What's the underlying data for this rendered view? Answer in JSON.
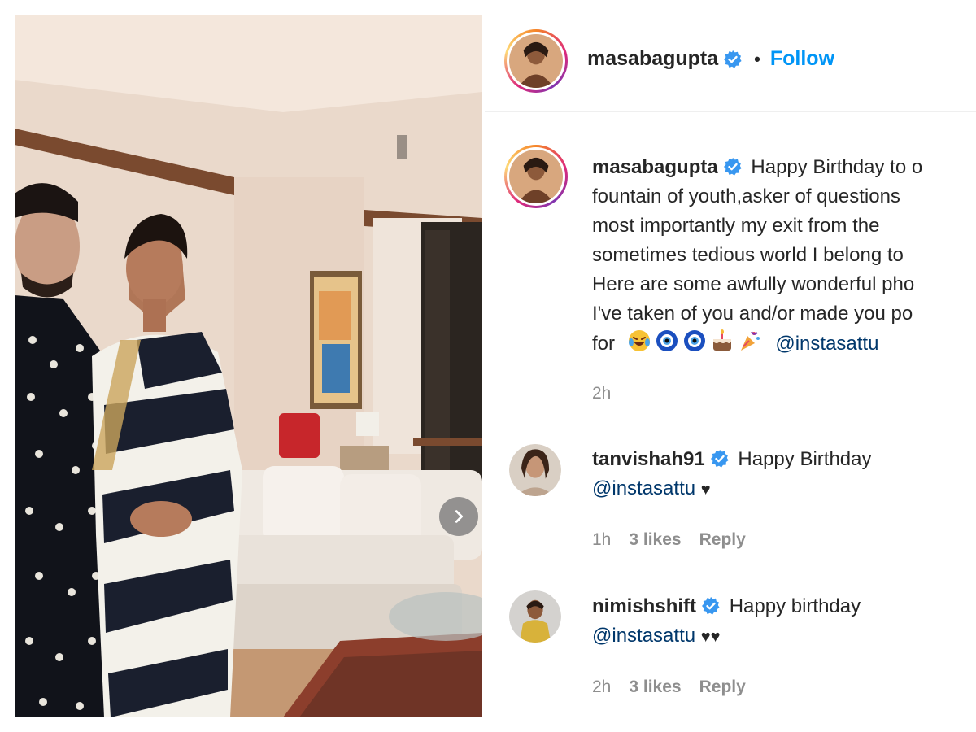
{
  "post": {
    "username": "masabagupta",
    "dot": "•",
    "follow_label": "Follow",
    "caption_lines": [
      "Happy Birthday to o",
      "fountain of youth,asker of questions",
      "most importantly my exit from the",
      "sometimes tedious world I belong to",
      "Here are some awfully wonderful pho",
      "I've taken of you and/or made you po"
    ],
    "caption_last_prefix": "for",
    "caption_mention": "@instasattu",
    "caption_emojis": [
      "laughing-tears-emoji",
      "evil-eye-emoji",
      "evil-eye-emoji",
      "birthday-cake-emoji",
      "party-popper-emoji"
    ],
    "time": "2h"
  },
  "comments": [
    {
      "username": "tanvishah91",
      "text": "Happy Birthday",
      "mention": "@instasattu",
      "hearts": "♥",
      "time": "1h",
      "likes": "3 likes",
      "reply_label": "Reply"
    },
    {
      "username": "nimishshift",
      "text": "Happy birthday",
      "mention": "@instasattu",
      "hearts": "♥♥",
      "time": "2h",
      "likes": "3 likes",
      "reply_label": "Reply"
    }
  ],
  "icons": {
    "verified": "verified-badge-icon",
    "next": "chevron-right-icon"
  },
  "colors": {
    "accent": "#0095f6",
    "verified": "#3897f0",
    "mention": "#00376b",
    "muted": "#8e8e8e"
  }
}
